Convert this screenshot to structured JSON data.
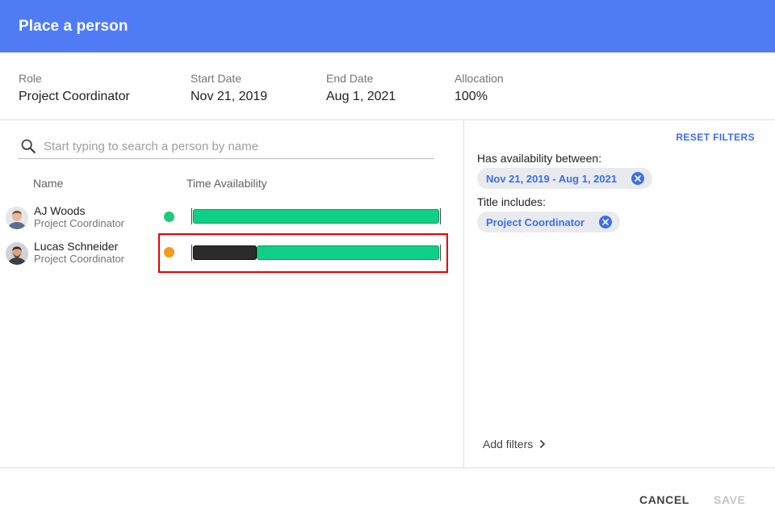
{
  "header": {
    "title": "Place a person"
  },
  "summary": [
    {
      "label": "Role",
      "value": "Project Coordinator"
    },
    {
      "label": "Start Date",
      "value": "Nov 21, 2019"
    },
    {
      "label": "End Date",
      "value": "Aug 1, 2021"
    },
    {
      "label": "Allocation",
      "value": "100%"
    }
  ],
  "search": {
    "placeholder": "Start typing to search a person by name",
    "value": ""
  },
  "columns": {
    "name": "Name",
    "availability": "Time Availability"
  },
  "people": [
    {
      "name": "AJ Woods",
      "title": "Project Coordinator",
      "status_color": "#1fc97a",
      "busy_fraction": 0.0
    },
    {
      "name": "Lucas Schneider",
      "title": "Project Coordinator",
      "status_color": "#f59a1b",
      "busy_fraction": 0.26
    }
  ],
  "filters": {
    "reset_label": "RESET FILTERS",
    "availability_label": "Has availability between:",
    "availability_value": "Nov 21, 2019 - Aug 1, 2021",
    "title_label": "Title includes:",
    "title_value": "Project Coordinator",
    "add_label": "Add filters"
  },
  "footer": {
    "cancel_label": "CANCEL",
    "save_label": "SAVE"
  },
  "colors": {
    "accent": "#4f7cf5",
    "link": "#3d6fe8",
    "available": "#10cf86",
    "busy": "#2b2b2b",
    "highlight": "#e60000"
  }
}
